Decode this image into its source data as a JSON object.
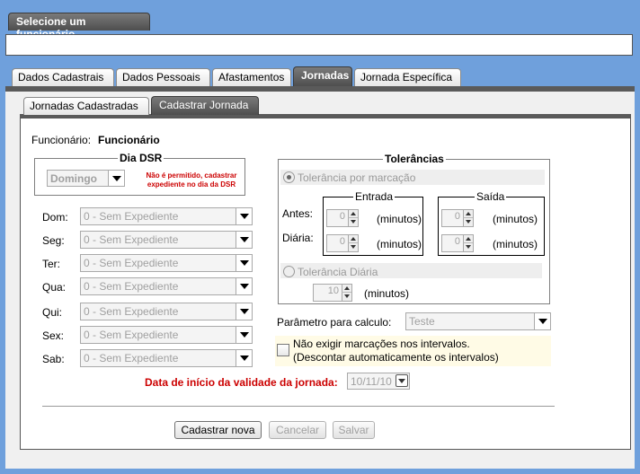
{
  "header": {
    "employee_select_tab": "Selecione um funcionário"
  },
  "main_tabs": [
    "Dados Cadastrais",
    "Dados Pessoais",
    "Afastamentos",
    "Jornadas",
    "Jornada Específica"
  ],
  "sub_tabs": [
    "Jornadas Cadastradas",
    "Cadastrar Jornada"
  ],
  "form": {
    "employee_label": "Funcionário:",
    "employee_value": "Funcionário",
    "dsr": {
      "title": "Dia DSR",
      "selected": "Domingo",
      "warning_line1": "Não é permitido, cadastrar",
      "warning_line2": "expediente no dia da DSR"
    },
    "days": [
      {
        "label": "Dom:",
        "value": "0 - Sem Expediente"
      },
      {
        "label": "Seg:",
        "value": "0 - Sem Expediente"
      },
      {
        "label": "Ter:",
        "value": "0 - Sem Expediente"
      },
      {
        "label": "Qua:",
        "value": "0 - Sem Expediente"
      },
      {
        "label": "Qui:",
        "value": "0 - Sem Expediente"
      },
      {
        "label": "Sex:",
        "value": "0 - Sem Expediente"
      },
      {
        "label": "Sab:",
        "value": "0 - Sem Expediente"
      }
    ],
    "tolerances": {
      "title": "Tolerâncias",
      "per_mark_label": "Tolerância por marcação",
      "entrada_title": "Entrada",
      "saida_title": "Saída",
      "antes_label": "Antes:",
      "diaria_label": "Diária:",
      "minutes": "(minutos)",
      "antes_entrada": "0",
      "antes_saida": "0",
      "diaria_entrada": "0",
      "diaria_saida": "0",
      "daily_label": "Tolerância Diária",
      "daily_value": "10"
    },
    "calc_param_label": "Parâmetro para calculo:",
    "calc_param_value": "Teste",
    "no_marks_line1": "Não exigir marcações nos intervalos.",
    "no_marks_line2": "(Descontar automaticamente os intervalos)",
    "validity_label": "Data de início da validade da jornada:",
    "validity_value": "10/11/10"
  },
  "buttons": {
    "register_new": "Cadastrar nova",
    "cancel": "Cancelar",
    "save": "Salvar"
  },
  "colors": {
    "background_blue": "#6fa0dc",
    "warning_red": "#cc0000",
    "tab_dark": "#5a5a5a"
  }
}
